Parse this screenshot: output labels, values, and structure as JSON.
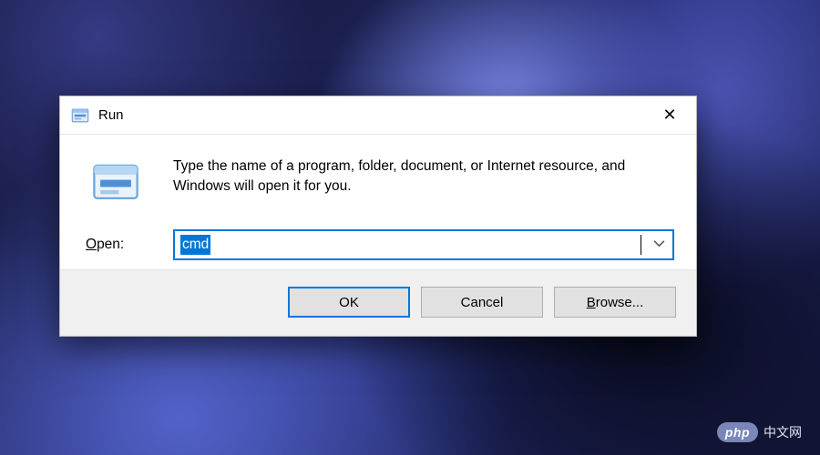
{
  "dialog": {
    "title": "Run",
    "description": "Type the name of a program, folder, document, or Internet resource, and Windows will open it for you.",
    "open_label_prefix": "O",
    "open_label_rest": "pen:",
    "input_value": "cmd",
    "buttons": {
      "ok": "OK",
      "cancel": "Cancel",
      "browse_prefix": "B",
      "browse_rest": "rowse..."
    },
    "close_glyph": "✕"
  },
  "watermark": {
    "pill": "php",
    "text": "中文网"
  },
  "colors": {
    "accent": "#0078d7"
  }
}
